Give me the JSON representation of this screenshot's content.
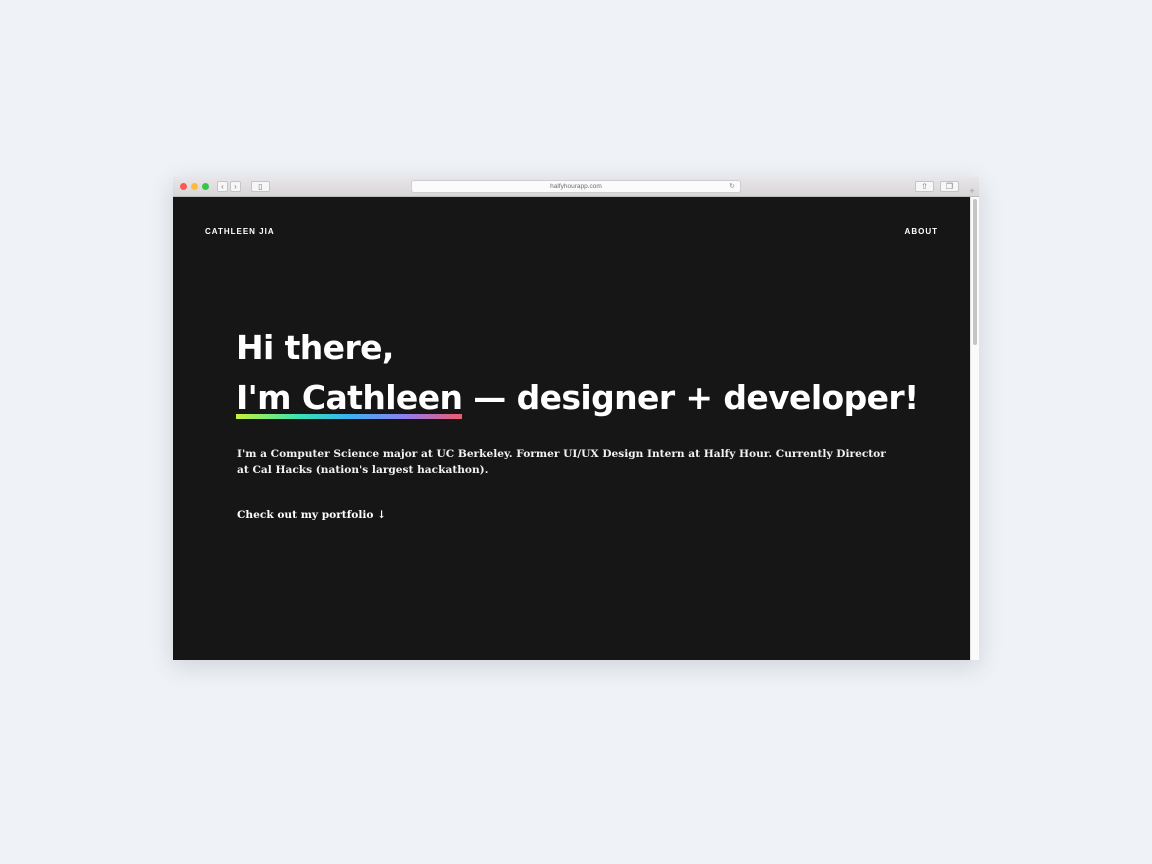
{
  "browser": {
    "url": "halfyhourapp.com",
    "icons": {
      "back": "chevron-left",
      "forward": "chevron-right",
      "sidebar": "sidebar-toggle",
      "reload": "reload",
      "share": "share",
      "tabs": "tab-overview",
      "new_tab": "plus"
    }
  },
  "site": {
    "brand": "CATHLEEN JIA",
    "nav_about": "ABOUT",
    "headline_line1": "Hi there,",
    "headline_name": "I'm Cathleen",
    "headline_rest": " — designer + developer!",
    "intro": "I'm a Computer Science major at UC Berkeley. Former UI/UX Design Intern at Halfy Hour. Currently Director at Cal Hacks (nation's largest hackathon).",
    "cta": "Check out my portfolio ↓"
  },
  "colors": {
    "page_background": "#eff2f6",
    "site_background": "#161616",
    "text": "#ffffff",
    "underline_gradient": [
      "#c6f23b",
      "#38e2b4",
      "#3bb2f0",
      "#8f7ef0",
      "#f05a6e"
    ]
  }
}
